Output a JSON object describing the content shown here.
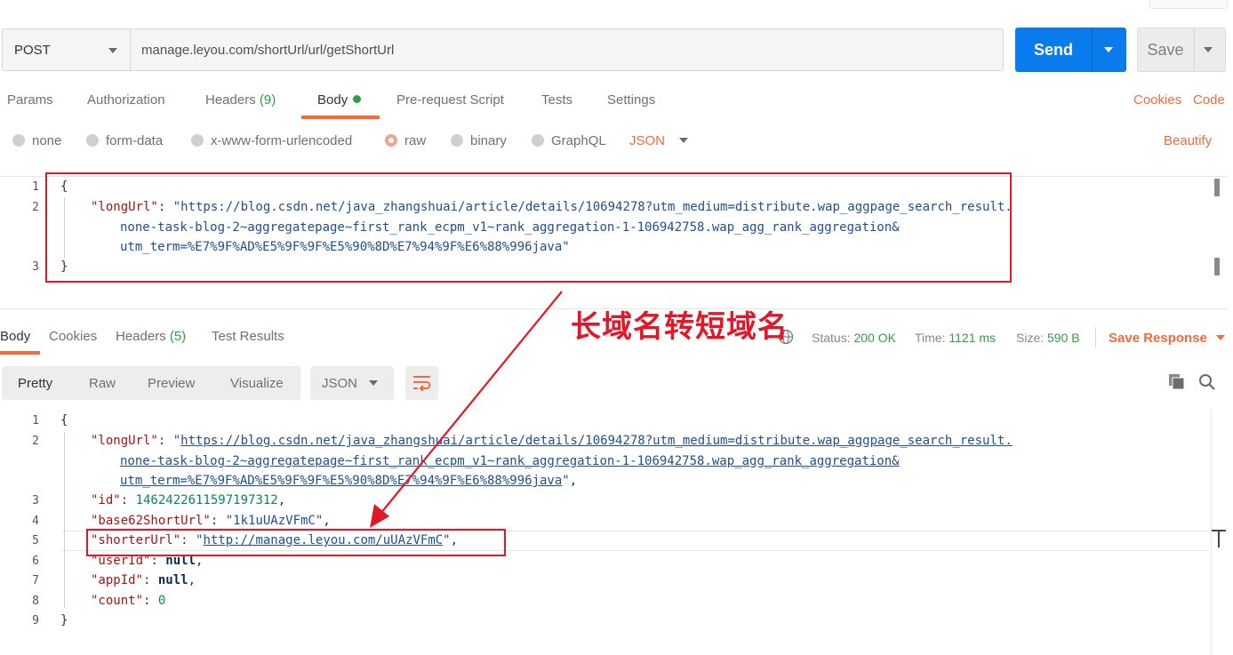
{
  "request": {
    "method": "POST",
    "url": "manage.leyou.com/shortUrl/url/getShortUrl",
    "send_label": "Send",
    "save_label": "Save"
  },
  "request_tabs": {
    "params": "Params",
    "authorization": "Authorization",
    "headers": "Headers",
    "headers_count": "(9)",
    "body": "Body",
    "prerequest": "Pre-request Script",
    "tests": "Tests",
    "settings": "Settings",
    "cookies": "Cookies",
    "code": "Code"
  },
  "body_types": {
    "none": "none",
    "form_data": "form-data",
    "urlencoded": "x-www-form-urlencoded",
    "raw": "raw",
    "binary": "binary",
    "graphql": "GraphQL",
    "format": "JSON",
    "beautify": "Beautify"
  },
  "request_body": {
    "line_numbers": [
      "1",
      "2",
      "3"
    ],
    "open": "{",
    "key": "\"longUrl\"",
    "colon": ": ",
    "value_line1": "\"https://blog.csdn.net/java_zhangshuai/article/details/10694278?utm_medium=distribute.wap_aggpage_search_result.",
    "value_line2": "none-task-blog-2~aggregatepage~first_rank_ecpm_v1~rank_aggregation-1-106942758.wap_agg_rank_aggregation&",
    "value_line3": "utm_term=%E7%9F%AD%E5%9F%9F%E5%90%8D%E7%94%9F%E6%88%996java\"",
    "close": "}"
  },
  "annotation": {
    "text": "长域名转短域名",
    "color": "#e0192a"
  },
  "response_tabs": {
    "body": "Body",
    "cookies": "Cookies",
    "headers": "Headers",
    "headers_count": "(5)",
    "test_results": "Test Results"
  },
  "response_status": {
    "status_label": "Status:",
    "status_value": "200 OK",
    "time_label": "Time:",
    "time_value": "1121 ms",
    "size_label": "Size:",
    "size_value": "590 B",
    "save_response": "Save Response"
  },
  "response_view": {
    "pretty": "Pretty",
    "raw": "Raw",
    "preview": "Preview",
    "visualize": "Visualize",
    "format": "JSON"
  },
  "response_body": {
    "line_numbers": [
      "1",
      "2",
      "3",
      "4",
      "5",
      "6",
      "7",
      "8",
      "9"
    ],
    "open": "{",
    "long_key": "\"longUrl\"",
    "long_q1": "\"",
    "long_url1": "https://blog.csdn.net/java_zhangshuai/article/details/10694278?utm_medium=distribute.wap_aggpage_search_result.",
    "long_url2": "none-task-blog-2~aggregatepage~first_rank_ecpm_v1~rank_aggregation-1-106942758.wap_agg_rank_aggregation&",
    "long_url3": "utm_term=%E7%9F%AD%E5%9F%9F%E5%90%8D%E7%94%9F%E6%88%996java",
    "long_q2": "\"",
    "id_key": "\"id\"",
    "id_value": "1462422611597197312",
    "base62_key": "\"base62ShortUrl\"",
    "base62_value": "\"1k1uUAzVFmC\"",
    "shorter_key": "\"shorterUrl\"",
    "shorter_q1": "\"",
    "shorter_url": "http://manage.leyou.com/uUAzVFmC",
    "shorter_q2": "\"",
    "userid_key": "\"userId\"",
    "userid_value": "null",
    "appid_key": "\"appId\"",
    "appid_value": "null",
    "count_key": "\"count\"",
    "count_value": "0",
    "close": "}"
  },
  "colors": {
    "accent": "#f26b3a",
    "send": "#097bed",
    "success": "#2e9e46"
  }
}
